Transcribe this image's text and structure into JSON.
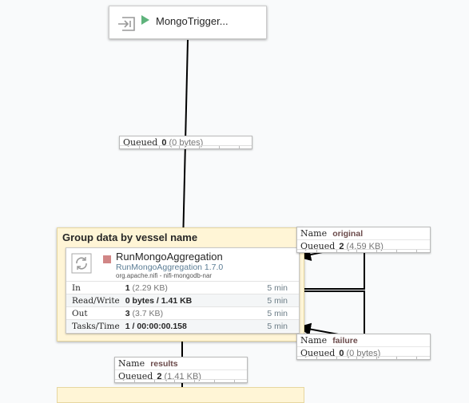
{
  "input_port": {
    "name": "MongoTrigger..."
  },
  "conn_trigger": {
    "queued_label": "Queued",
    "queued_count": "0",
    "queued_size": "(0 bytes)"
  },
  "group": {
    "title": "Group data by vessel name"
  },
  "processor": {
    "name": "RunMongoAggregation",
    "type": "RunMongoAggregation 1.7.0",
    "bundle": "org.apache.nifi - nifi-mongodb-nar",
    "stats": [
      {
        "key": "In",
        "value": "1",
        "extra": "(2.29 KB)",
        "time": "5 min"
      },
      {
        "key": "Read/Write",
        "value": "0 bytes / 1.41 KB",
        "extra": "",
        "time": "5 min"
      },
      {
        "key": "Out",
        "value": "3",
        "extra": "(3.7 KB)",
        "time": "5 min"
      },
      {
        "key": "Tasks/Time",
        "value": "1 / 00:00:00.158",
        "extra": "",
        "time": "5 min"
      }
    ]
  },
  "conn_original": {
    "name_label": "Name",
    "name": "original",
    "queued_label": "Queued",
    "queued_count": "2",
    "queued_size": "(4.59 KB)"
  },
  "conn_failure": {
    "name_label": "Name",
    "name": "failure",
    "queued_label": "Queued",
    "queued_count": "0",
    "queued_size": "(0 bytes)"
  },
  "conn_results": {
    "name_label": "Name",
    "name": "results",
    "queued_label": "Queued",
    "queued_count": "2",
    "queued_size": "(1.41 KB)"
  },
  "colors": {
    "canvas": "#f9fafb",
    "group_fill": "#fff5d6",
    "run_green": "#5fb37c",
    "stopped_red": "#d18686",
    "type_blue": "#5b7d95"
  },
  "icons": {
    "port": "input-port-icon",
    "run": "play-icon",
    "processor": "processor-icon",
    "stopped": "stop-icon"
  }
}
